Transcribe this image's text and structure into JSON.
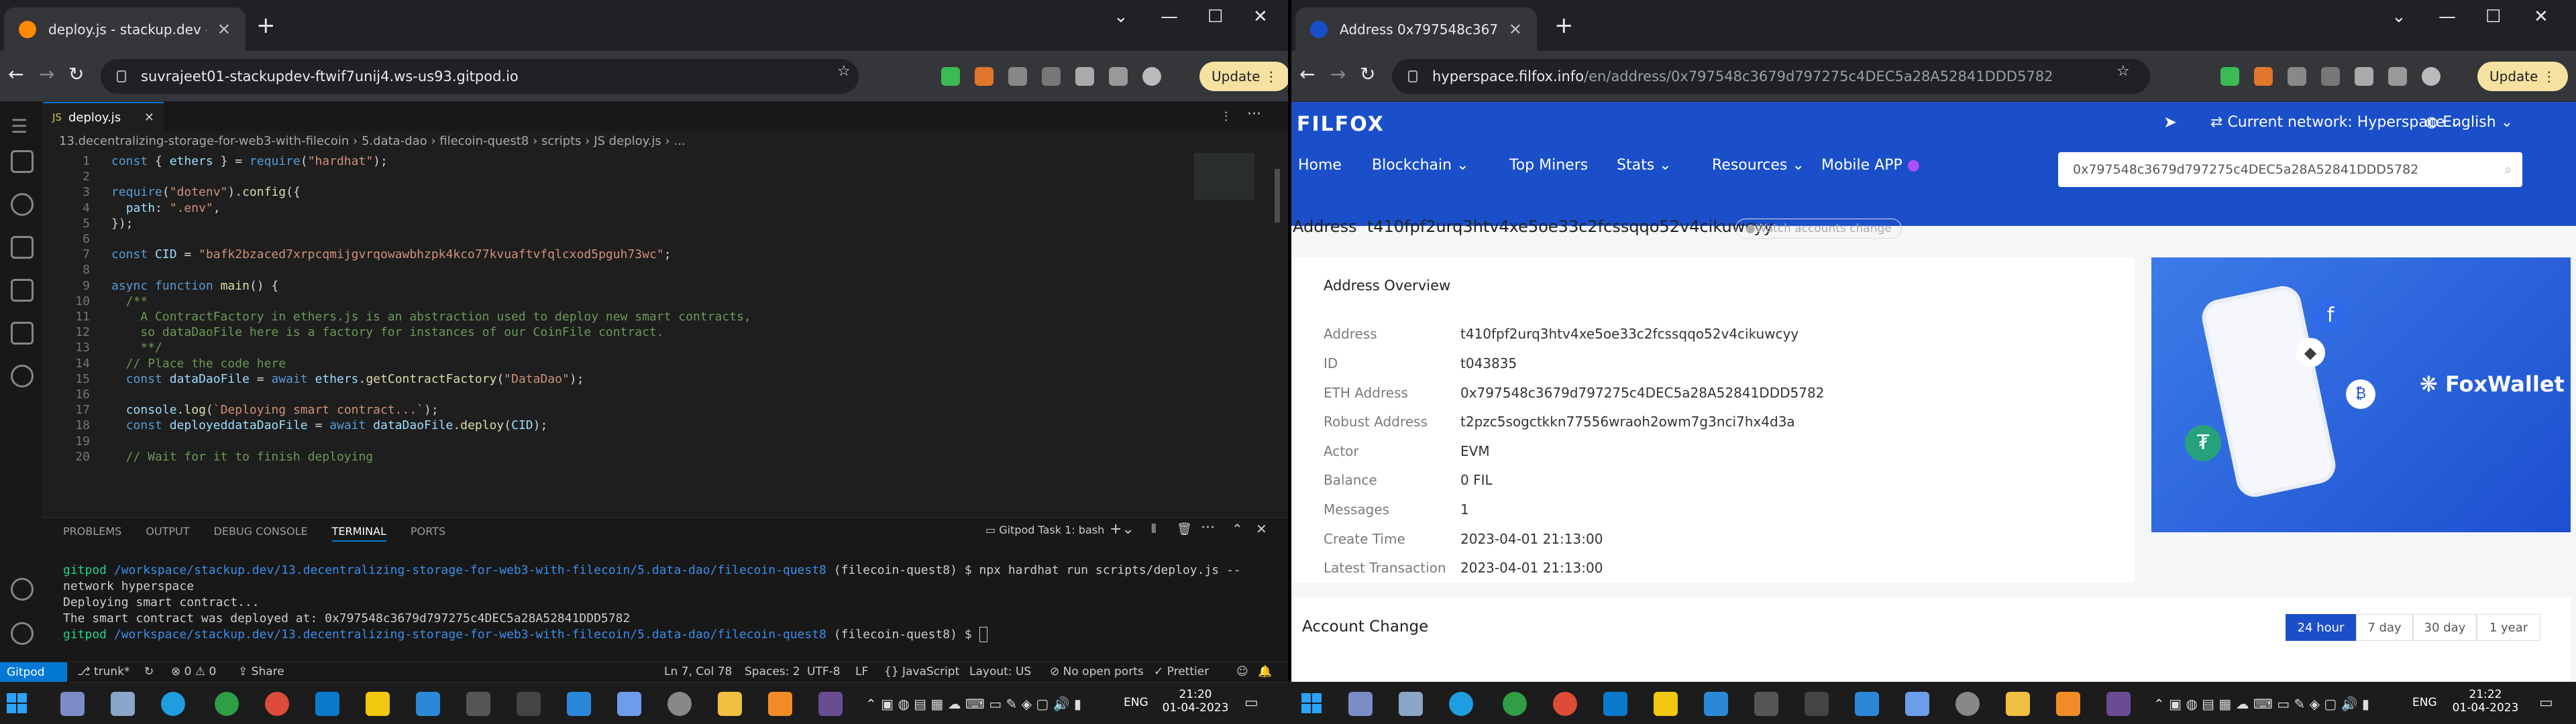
{
  "left": {
    "tab_title": "deploy.js - stackup.dev - Gitpod",
    "url": "suvrajeet01-stackupdev-ftwif7unij4.ws-us93.gitpod.io",
    "update_label": "Update",
    "editor_tab": "deploy.js",
    "breadcrumb": [
      "13.decentralizing-storage-for-web3-with-filecoin",
      "5.data-dao",
      "filecoin-quest8",
      "scripts",
      "JS deploy.js",
      "..."
    ],
    "code_lines": [
      {
        "n": "1",
        "t": "const { ethers } = require(\"hardhat\");"
      },
      {
        "n": "2",
        "t": ""
      },
      {
        "n": "3",
        "t": "require(\"dotenv\").config({"
      },
      {
        "n": "4",
        "t": "  path: \".env\","
      },
      {
        "n": "5",
        "t": "});"
      },
      {
        "n": "6",
        "t": ""
      },
      {
        "n": "7",
        "t": "const CID = \"bafk2bzaced7xrpcqmijgvrqowawbhzpk4kco77kvuaftvfqlcxod5pguh73wc\";"
      },
      {
        "n": "8",
        "t": ""
      },
      {
        "n": "9",
        "t": "async function main() {"
      },
      {
        "n": "10",
        "t": "  /**"
      },
      {
        "n": "11",
        "t": "    A ContractFactory in ethers.js is an abstraction used to deploy new smart contracts,"
      },
      {
        "n": "12",
        "t": "    so dataDaoFile here is a factory for instances of our CoinFile contract."
      },
      {
        "n": "13",
        "t": "    **/"
      },
      {
        "n": "14",
        "t": "  // Place the code here"
      },
      {
        "n": "15",
        "t": "  const dataDaoFile = await ethers.getContractFactory(\"DataDao\");"
      },
      {
        "n": "16",
        "t": ""
      },
      {
        "n": "17",
        "t": "  console.log(`Deploying smart contract...`);"
      },
      {
        "n": "18",
        "t": "  const deployeddataDaoFile = await dataDaoFile.deploy(CID);"
      },
      {
        "n": "19",
        "t": ""
      },
      {
        "n": "20",
        "t": "  // Wait for it to finish deploying"
      }
    ],
    "panel_tabs": [
      "PROBLEMS",
      "OUTPUT",
      "DEBUG CONSOLE",
      "TERMINAL",
      "PORTS"
    ],
    "terminal_task": "Gitpod Task 1: bash",
    "terminal": {
      "prompt_user": "gitpod",
      "path": "/workspace/stackup.dev/13.decentralizing-storage-for-web3-with-filecoin/5.data-dao/filecoin-quest8",
      "branch": "(filecoin-quest8)",
      "command": "$ npx hardhat run scripts/deploy.js --",
      "command_cont": "network hyperspace",
      "out1": "Deploying smart contract...",
      "out2": "The smart contract was deployed at: 0x797548c3679d797275c4DEC5a28A52841DDD5782",
      "prompt_end": "$ "
    },
    "status": {
      "gitpod": "Gitpod",
      "branch": "trunk*",
      "problems": "⊗ 0 ⚠ 0",
      "share": "Share",
      "position": "Ln 7, Col 78",
      "spaces": "Spaces: 2",
      "encoding": "UTF-8",
      "eol": "LF",
      "lang": "JavaScript",
      "layout": "Layout: US",
      "ports": "No open ports",
      "prettier": "Prettier"
    }
  },
  "right": {
    "tab_title": "Address 0x797548c3679d797275c",
    "url": "hyperspace.filfox.info",
    "url_path": "/en/address/0x797548c3679d797275c4DEC5a28A52841DDD5782",
    "update_label": "Update",
    "logo": "FILFOX",
    "network": "Current network: Hyperspace",
    "language": "English",
    "nav": [
      "Home",
      "Blockchain",
      "Top Miners",
      "Stats",
      "Resources",
      "Mobile APP"
    ],
    "search_value": "0x797548c3679d797275c4DEC5a28A52841DDD5782",
    "address_label": "Address",
    "address_value": "t410fpf2urq3htv4xe5oe33c2fcssqqo52v4cikuwcyy",
    "watch_label": "Watch accounts change",
    "overview_title": "Address Overview",
    "overview": [
      {
        "k": "Address",
        "v": "t410fpf2urq3htv4xe5oe33c2fcssqqo52v4cikuwcyy"
      },
      {
        "k": "ID",
        "v": "t043835"
      },
      {
        "k": "ETH Address",
        "v": "0x797548c3679d797275c4DEC5a28A52841DDD5782"
      },
      {
        "k": "Robust Address",
        "v": "t2pzc5sogctkkn77556wraoh2owm7g3nci7hx4d3a"
      },
      {
        "k": "Actor",
        "v": "EVM"
      },
      {
        "k": "Balance",
        "v": "0 FIL"
      },
      {
        "k": "Messages",
        "v": "1"
      },
      {
        "k": "Create Time",
        "v": "2023-04-01 21:13:00"
      },
      {
        "k": "Latest Transaction",
        "v": "2023-04-01 21:13:00"
      }
    ],
    "ad_brand": "FoxWallet",
    "account_change": "Account Change",
    "ranges": [
      "24 hour",
      "7 day",
      "30 day",
      "1 year"
    ]
  },
  "taskbar_left": {
    "lang": "ENG",
    "time": "21:20",
    "date": "01-04-2023"
  },
  "taskbar_right": {
    "lang": "ENG",
    "time": "21:22",
    "date": "01-04-2023"
  },
  "colors": {
    "filfox_blue": "#1a4fc9",
    "vscode_bg": "#1e1e1e",
    "gitpod_orange": "#ff8a00"
  }
}
